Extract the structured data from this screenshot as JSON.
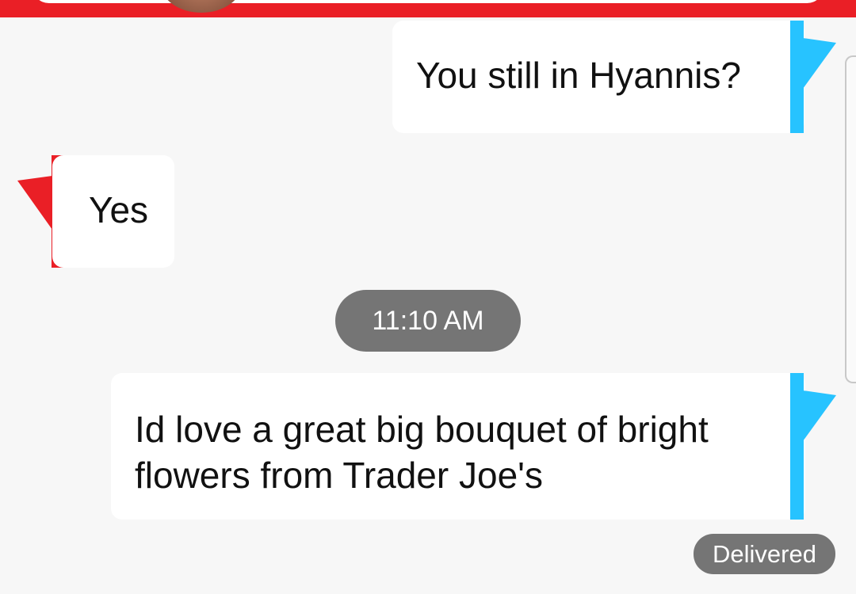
{
  "header": {
    "accent_color": "#ea1f26",
    "avatar_icon": "contact-avatar-icon"
  },
  "messages": [
    {
      "direction": "outgoing",
      "text": "You still in Hyannis?"
    },
    {
      "direction": "incoming",
      "text": "Yes"
    },
    {
      "direction": "outgoing",
      "text": "Id love a great big bouquet of bright flowers from Trader Joe's"
    }
  ],
  "timestamp_divider": "11:10 AM",
  "delivery_status": "Delivered",
  "colors": {
    "outgoing_accent": "#27c3ff",
    "incoming_accent": "#ea1f26",
    "background": "#f7f7f7",
    "bubble": "#ffffff",
    "pill": "#757575"
  }
}
